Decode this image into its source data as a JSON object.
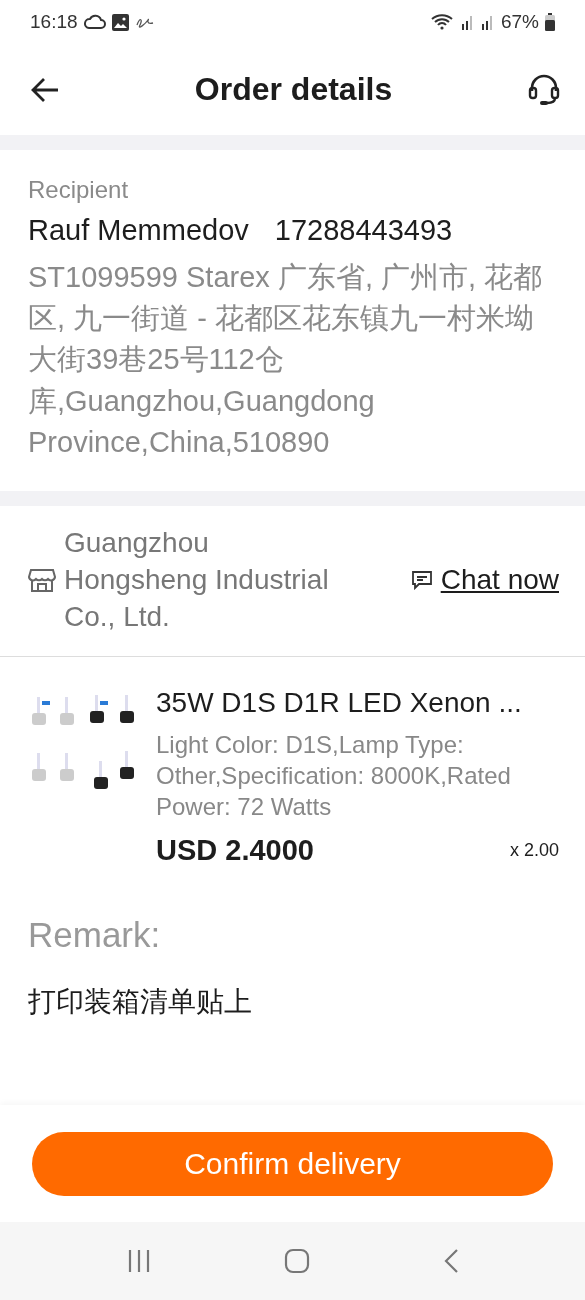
{
  "status_bar": {
    "time": "16:18",
    "battery": "67%"
  },
  "header": {
    "title": "Order details"
  },
  "recipient": {
    "label": "Recipient",
    "name": "Rauf Memmedov",
    "phone": "17288443493",
    "address": "ST1099599 Starex 广东省, 广州市, 花都区, 九一街道 - 花都区花东镇九一村米坳大街39巷25号112仓库,Guangzhou,Guangdong Province,China,510890"
  },
  "seller": {
    "name": "Guangzhou Hongsheng Industrial Co., Ltd.",
    "chat": "Chat now"
  },
  "product": {
    "title": "35W D1S D1R LED Xenon ...",
    "specs": "Light Color: D1S,Lamp Type: Other,Specification: 8000K,Rated Power: 72 Watts",
    "price": "USD 2.4000",
    "quantity": "x 2.00"
  },
  "remark": {
    "label": "Remark:",
    "text": "打印装箱清单贴上"
  },
  "footer": {
    "button": "Confirm delivery"
  }
}
